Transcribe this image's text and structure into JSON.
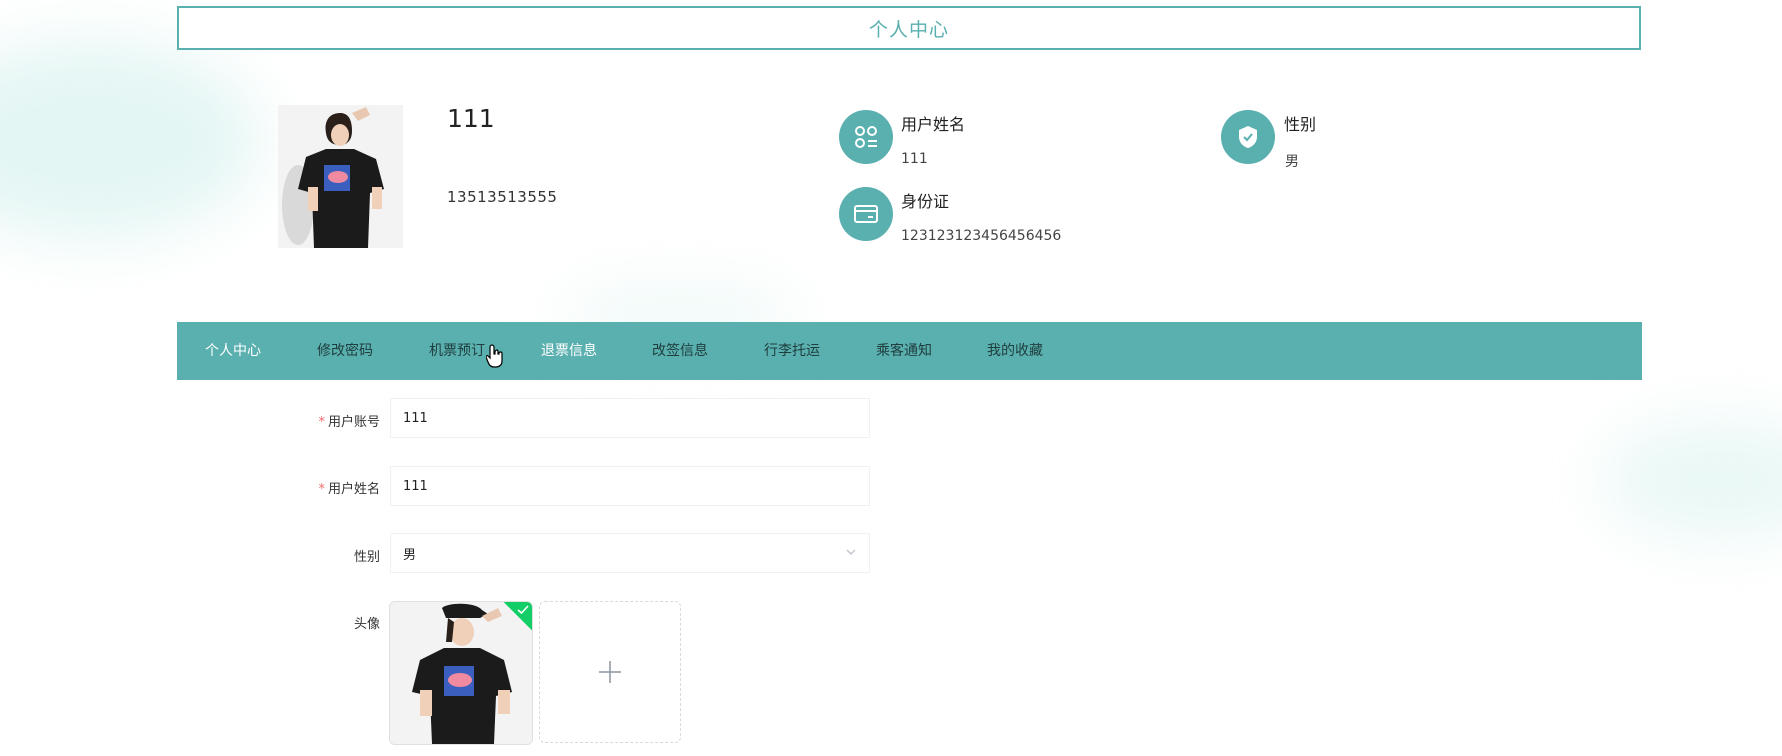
{
  "header": {
    "title": "个人中心"
  },
  "profile": {
    "name": "111",
    "phone": "13513513555",
    "fields": [
      {
        "icon": "user-list-icon",
        "label": "用户姓名",
        "value": "111"
      },
      {
        "icon": "shield-check-icon",
        "label": "性别",
        "value": "男"
      },
      {
        "icon": "id-card-icon",
        "label": "身份证",
        "value": "123123123456456456"
      }
    ]
  },
  "tabs": [
    {
      "label": "个人中心",
      "active": true
    },
    {
      "label": "修改密码"
    },
    {
      "label": "机票预订"
    },
    {
      "label": "退票信息"
    },
    {
      "label": "改签信息"
    },
    {
      "label": "行李托运"
    },
    {
      "label": "乘客通知"
    },
    {
      "label": "我的收藏"
    }
  ],
  "form": {
    "account": {
      "label": "用户账号",
      "value": "111",
      "required": "*"
    },
    "username": {
      "label": "用户姓名",
      "value": "111",
      "required": "*"
    },
    "gender": {
      "label": "性别",
      "value": "男"
    },
    "avatar": {
      "label": "头像"
    }
  },
  "colors": {
    "accent": "#5aafaf",
    "success": "#13ce66",
    "required": "#f56c6c"
  }
}
